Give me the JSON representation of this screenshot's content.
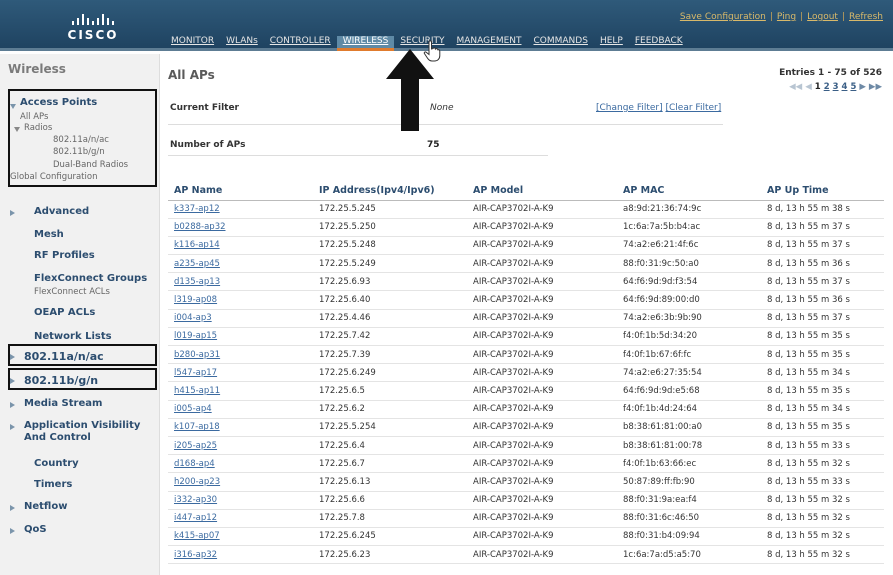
{
  "header": {
    "logo_text": "CISCO",
    "utility_links": [
      "Save Configuration",
      "Ping",
      "Logout",
      "Refresh"
    ],
    "nav": [
      {
        "label": "MONITOR"
      },
      {
        "label": "WLANs"
      },
      {
        "label": "CONTROLLER"
      },
      {
        "label": "WIRELESS",
        "active": true
      },
      {
        "label": "SECURITY"
      },
      {
        "label": "MANAGEMENT"
      },
      {
        "label": "COMMANDS"
      },
      {
        "label": "HELP"
      },
      {
        "label": "FEEDBACK"
      }
    ],
    "active_color": "#e07b2d"
  },
  "sidebar": {
    "title": "Wireless",
    "access_points": {
      "label": "Access Points",
      "all_aps": "All APs",
      "radios": "Radios",
      "radio_items": [
        "802.11a/n/ac",
        "802.11b/g/n",
        "Dual-Band Radios"
      ],
      "global_config": "Global Configuration"
    },
    "advanced": "Advanced",
    "mesh": "Mesh",
    "rf_profiles": "RF Profiles",
    "flexconnect_groups": "FlexConnect Groups",
    "flexconnect_acls": "FlexConnect ACLs",
    "oeap_acls": "OEAP ACLs",
    "network_lists": "Network Lists",
    "band_a": "802.11a/n/ac",
    "band_b": "802.11b/g/n",
    "media_stream": "Media Stream",
    "avc_line1": "Application Visibility",
    "avc_line2": "And Control",
    "country": "Country",
    "timers": "Timers",
    "netflow": "Netflow",
    "qos": "QoS"
  },
  "main": {
    "title": "All APs",
    "entries": "Entries 1 - 75 of 526",
    "pages": [
      "1",
      "2",
      "3",
      "4",
      "5"
    ],
    "current_page": "1",
    "current_filter_label": "Current Filter",
    "current_filter_value": "None",
    "change_filter": "[Change Filter]",
    "clear_filter": "[Clear Filter]",
    "num_aps_label": "Number of APs",
    "num_aps_value": "75",
    "columns": [
      "AP Name",
      "IP Address(Ipv4/Ipv6)",
      "AP Model",
      "AP MAC",
      "AP Up Time"
    ],
    "rows": [
      [
        "k337-ap12",
        "172.25.5.245",
        "AIR-CAP3702I-A-K9",
        "a8:9d:21:36:74:9c",
        "8 d, 13 h 55 m 38 s"
      ],
      [
        "b0288-ap32",
        "172.25.5.250",
        "AIR-CAP3702I-A-K9",
        "1c:6a:7a:5b:b4:ac",
        "8 d, 13 h 55 m 37 s"
      ],
      [
        "k116-ap14",
        "172.25.5.248",
        "AIR-CAP3702I-A-K9",
        "74:a2:e6:21:4f:6c",
        "8 d, 13 h 55 m 37 s"
      ],
      [
        "a235-ap45",
        "172.25.5.249",
        "AIR-CAP3702I-A-K9",
        "88:f0:31:9c:50:a0",
        "8 d, 13 h 55 m 36 s"
      ],
      [
        "d135-ap13",
        "172.25.6.93",
        "AIR-CAP3702I-A-K9",
        "64:f6:9d:9d:f3:54",
        "8 d, 13 h 55 m 37 s"
      ],
      [
        "l319-ap08",
        "172.25.6.40",
        "AIR-CAP3702I-A-K9",
        "64:f6:9d:89:00:d0",
        "8 d, 13 h 55 m 36 s"
      ],
      [
        "i004-ap3",
        "172.25.4.46",
        "AIR-CAP3702I-A-K9",
        "74:a2:e6:3b:9b:90",
        "8 d, 13 h 55 m 37 s"
      ],
      [
        "l019-ap15",
        "172.25.7.42",
        "AIR-CAP3702I-A-K9",
        "f4:0f:1b:5d:34:20",
        "8 d, 13 h 55 m 35 s"
      ],
      [
        "b280-ap31",
        "172.25.7.39",
        "AIR-CAP3702I-A-K9",
        "f4:0f:1b:67:6f:fc",
        "8 d, 13 h 55 m 35 s"
      ],
      [
        "l547-ap17",
        "172.25.6.249",
        "AIR-CAP3702I-A-K9",
        "74:a2:e6:27:35:54",
        "8 d, 13 h 55 m 34 s"
      ],
      [
        "h415-ap11",
        "172.25.6.5",
        "AIR-CAP3702I-A-K9",
        "64:f6:9d:9d:e5:68",
        "8 d, 13 h 55 m 35 s"
      ],
      [
        "i005-ap4",
        "172.25.6.2",
        "AIR-CAP3702I-A-K9",
        "f4:0f:1b:4d:24:64",
        "8 d, 13 h 55 m 34 s"
      ],
      [
        "k107-ap18",
        "172.25.5.254",
        "AIR-CAP3702I-A-K9",
        "b8:38:61:81:00:a0",
        "8 d, 13 h 55 m 35 s"
      ],
      [
        "i205-ap25",
        "172.25.6.4",
        "AIR-CAP3702I-A-K9",
        "b8:38:61:81:00:78",
        "8 d, 13 h 55 m 33 s"
      ],
      [
        "d168-ap4",
        "172.25.6.7",
        "AIR-CAP3702I-A-K9",
        "f4:0f:1b:63:66:ec",
        "8 d, 13 h 55 m 32 s"
      ],
      [
        "h200-ap23",
        "172.25.6.13",
        "AIR-CAP3702I-A-K9",
        "50:87:89:ff:fb:90",
        "8 d, 13 h 55 m 33 s"
      ],
      [
        "i332-ap30",
        "172.25.6.6",
        "AIR-CAP3702I-A-K9",
        "88:f0:31:9a:ea:f4",
        "8 d, 13 h 55 m 32 s"
      ],
      [
        "i447-ap12",
        "172.25.7.8",
        "AIR-CAP3702I-A-K9",
        "88:f0:31:6c:46:50",
        "8 d, 13 h 55 m 32 s"
      ],
      [
        "k415-ap07",
        "172.25.6.245",
        "AIR-CAP3702I-A-K9",
        "88:f0:31:b4:09:94",
        "8 d, 13 h 55 m 32 s"
      ],
      [
        "i316-ap32",
        "172.25.6.23",
        "AIR-CAP3702I-A-K9",
        "1c:6a:7a:d5:a5:70",
        "8 d, 13 h 55 m 32 s"
      ]
    ]
  }
}
